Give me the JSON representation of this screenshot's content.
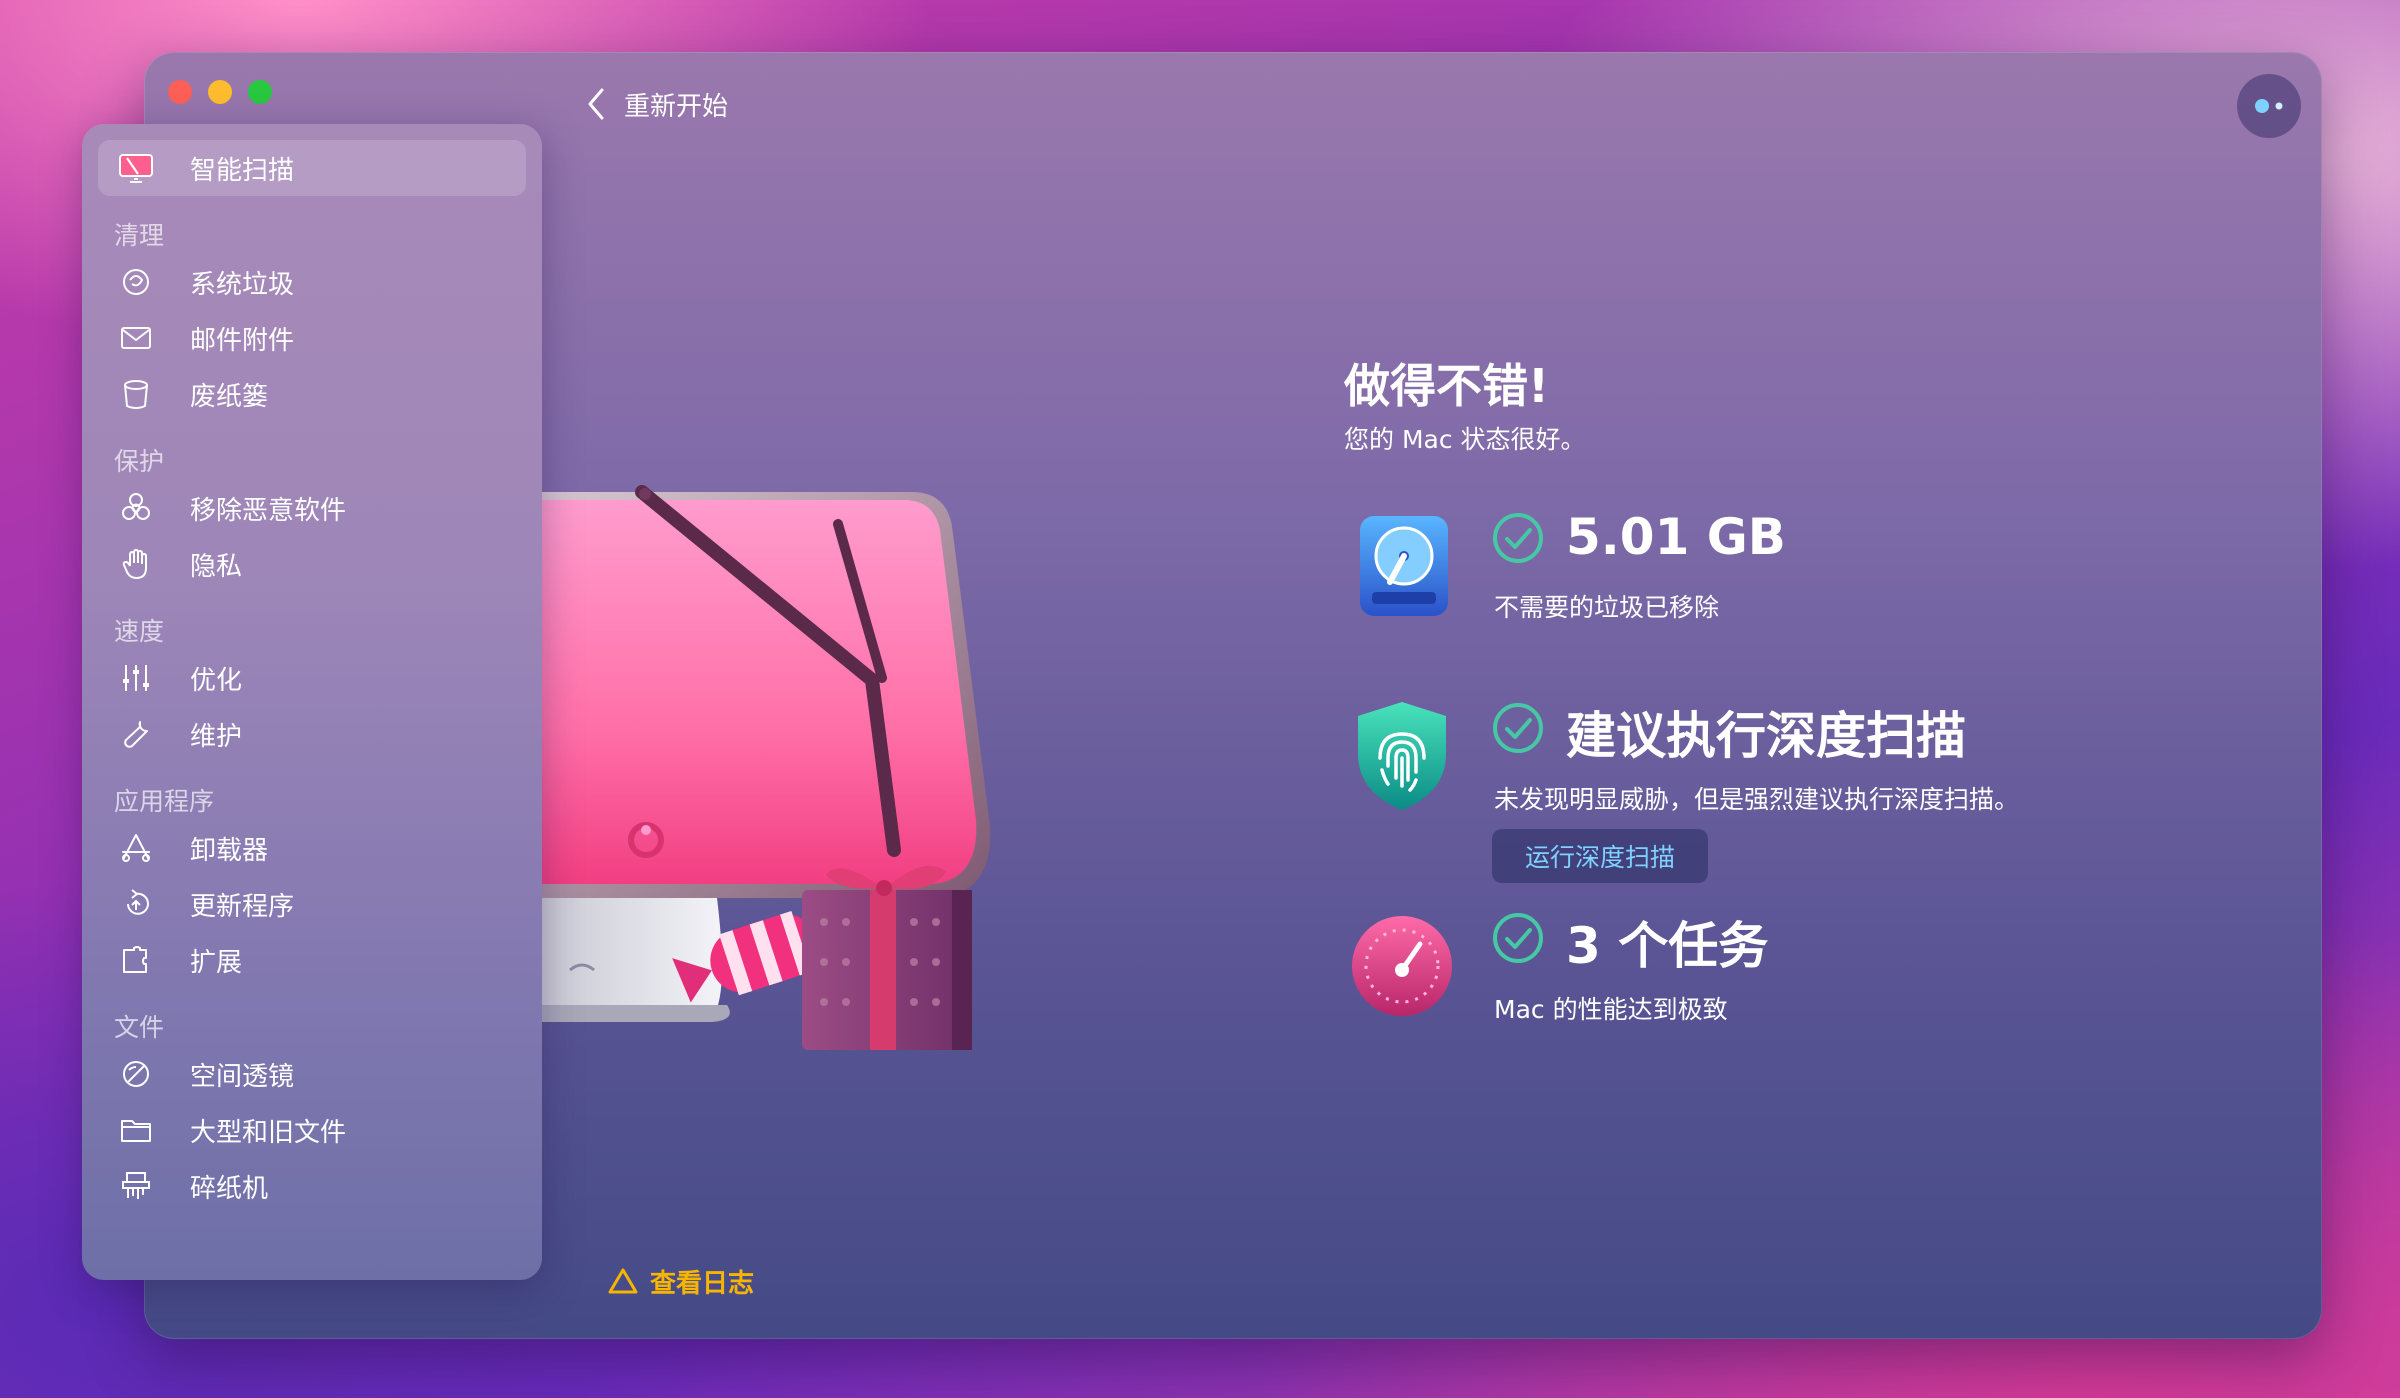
{
  "window": {
    "back_label": "重新开始"
  },
  "sidebar": {
    "active": {
      "label": "智能扫描",
      "icon": "smart-scan-icon"
    },
    "sections": [
      {
        "title": "清理",
        "items": [
          {
            "label": "系统垃圾",
            "icon": "system-junk-icon"
          },
          {
            "label": "邮件附件",
            "icon": "mail-icon"
          },
          {
            "label": "废纸篓",
            "icon": "trash-icon"
          }
        ]
      },
      {
        "title": "保护",
        "items": [
          {
            "label": "移除恶意软件",
            "icon": "biohazard-icon"
          },
          {
            "label": "隐私",
            "icon": "hand-icon"
          }
        ]
      },
      {
        "title": "速度",
        "items": [
          {
            "label": "优化",
            "icon": "sliders-icon"
          },
          {
            "label": "维护",
            "icon": "wrench-icon"
          }
        ]
      },
      {
        "title": "应用程序",
        "items": [
          {
            "label": "卸载器",
            "icon": "uninstaller-icon"
          },
          {
            "label": "更新程序",
            "icon": "updater-icon"
          },
          {
            "label": "扩展",
            "icon": "extensions-icon"
          }
        ]
      },
      {
        "title": "文件",
        "items": [
          {
            "label": "空间透镜",
            "icon": "space-lens-icon"
          },
          {
            "label": "大型和旧文件",
            "icon": "folder-icon"
          },
          {
            "label": "碎纸机",
            "icon": "shredder-icon"
          }
        ]
      }
    ]
  },
  "main": {
    "title": "做得不错!",
    "subtitle": "您的 Mac 状态很好。",
    "results": [
      {
        "value": "5.01 GB",
        "desc": "不需要的垃圾已移除",
        "icon": "hard-drive-icon"
      },
      {
        "value": "建议执行深度扫描",
        "desc": "未发现明显威胁，但是强烈建议执行深度扫描。",
        "icon": "fingerprint-shield-icon",
        "button": "运行深度扫描"
      },
      {
        "value": "3 个任务",
        "desc": "Mac 的性能达到极致",
        "icon": "speedometer-icon"
      }
    ],
    "view_log": "查看日志"
  },
  "colors": {
    "accent_check": "#47c8a4",
    "link_blue": "#7fd1ff",
    "warning_yellow": "#f7b500"
  }
}
